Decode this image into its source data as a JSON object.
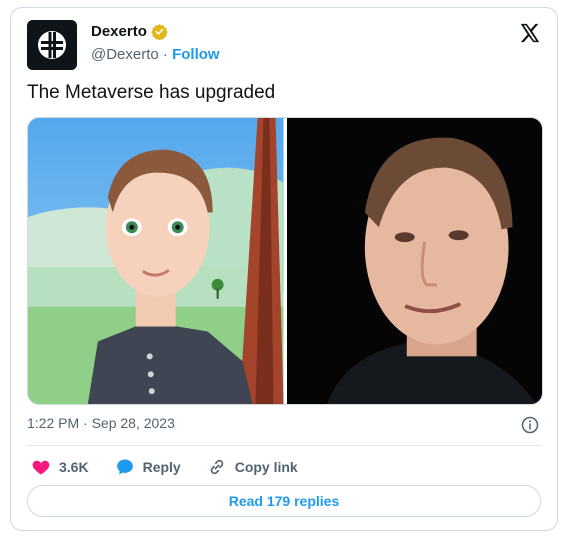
{
  "author": {
    "name": "Dexerto",
    "handle": "@Dexerto",
    "separator": "·",
    "follow_label": "Follow"
  },
  "tweet": {
    "text": "The Metaverse has upgraded",
    "timestamp": "1:22 PM · Sep 28, 2023"
  },
  "actions": {
    "likes_count": "3.6K",
    "reply_label": "Reply",
    "copy_link_label": "Copy link",
    "read_replies_label": "Read 179 replies"
  },
  "colors": {
    "accent": "#1d9bf0",
    "like": "#f91880",
    "verified": "#e2b719"
  },
  "icons": {
    "brand": "x-logo-icon",
    "verified": "verified-badge-icon",
    "info": "info-icon",
    "like": "heart-icon",
    "reply": "chat-bubble-icon",
    "copy_link": "link-icon"
  }
}
